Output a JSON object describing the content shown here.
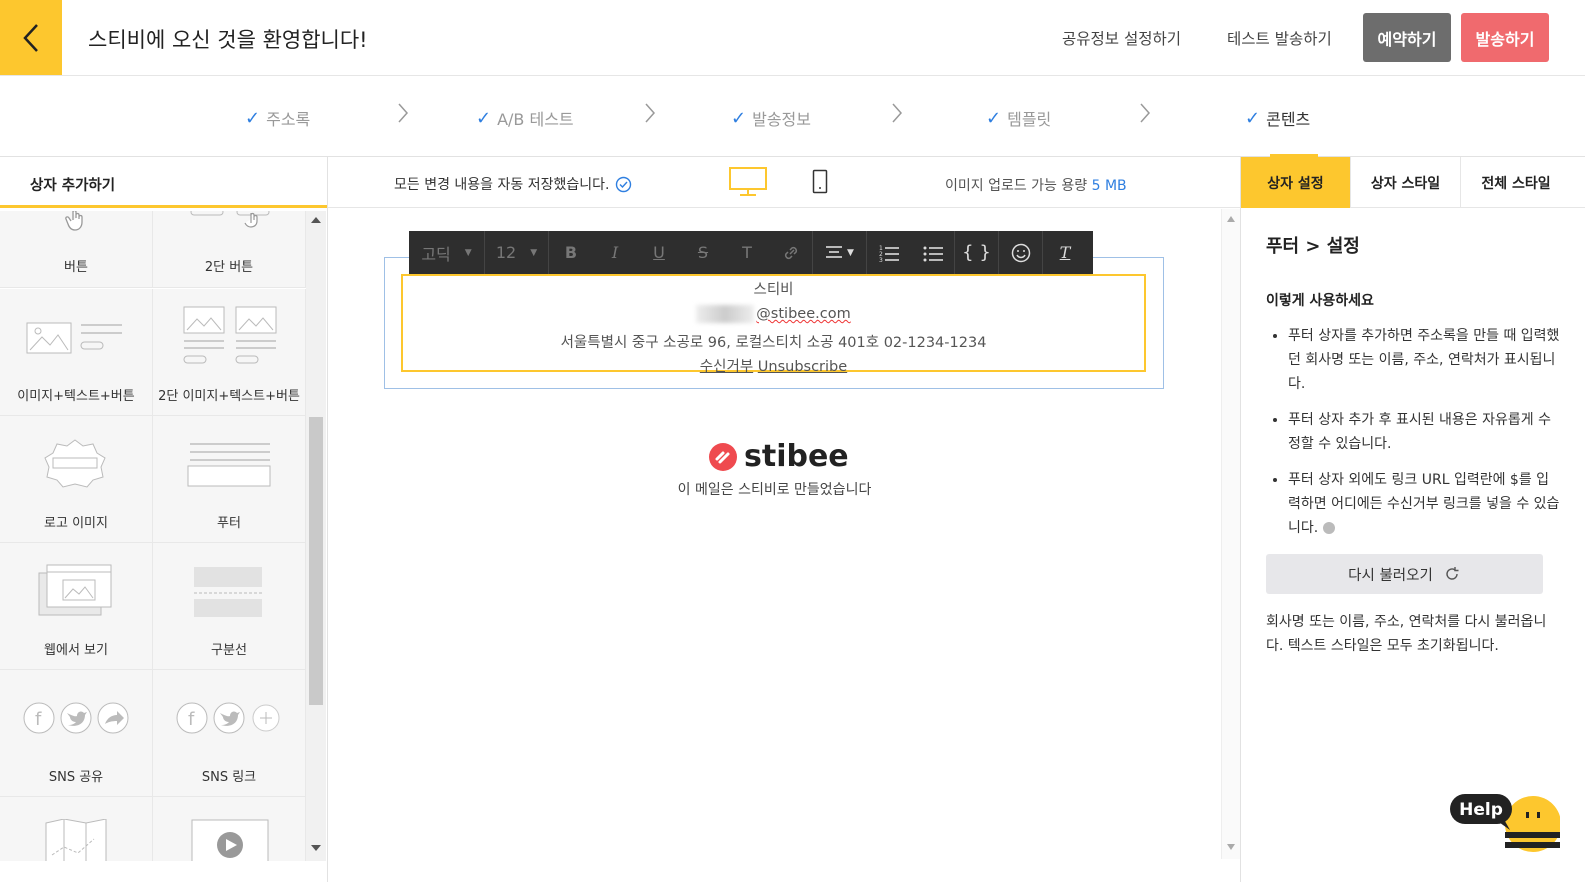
{
  "header": {
    "title": "스티비에 오신 것을 환영합니다!",
    "share_settings": "공유정보 설정하기",
    "test_send": "테스트 발송하기",
    "reserve": "예약하기",
    "send": "발송하기"
  },
  "steps": [
    {
      "label": "주소록"
    },
    {
      "label": "A/B 테스트"
    },
    {
      "label": "발송정보"
    },
    {
      "label": "템플릿"
    },
    {
      "label": "콘텐츠"
    }
  ],
  "left_panel": {
    "title": "상자 추가하기",
    "blocks": [
      {
        "label": "버튼"
      },
      {
        "label": "2단 버튼"
      },
      {
        "label": "이미지+텍스트+버튼"
      },
      {
        "label": "2단 이미지+텍스트+버튼"
      },
      {
        "label": "로고 이미지"
      },
      {
        "label": "푸터"
      },
      {
        "label": "웹에서 보기"
      },
      {
        "label": "구분선"
      },
      {
        "label": "SNS 공유"
      },
      {
        "label": "SNS 링크"
      }
    ]
  },
  "center": {
    "autosave": "모든 변경 내용을 자동 저장했습니다.",
    "upload_label": "이미지 업로드 가능 용량",
    "upload_size": "5 MB",
    "toolbar": {
      "font": "고딕",
      "size": "12",
      "bold": "B",
      "italic": "I",
      "underline": "U",
      "strike": "S",
      "textcolor": "T",
      "code": "{ }",
      "clear": "T"
    },
    "footer": {
      "name": "스티비",
      "email_domain": "@stibee.com",
      "address": "서울특별시 중구 소공로 96, 로컬스티치 소공 401호 02-1234-1234",
      "unsub_ko": "수신거부",
      "unsub_en": "Unsubscribe"
    },
    "brand": "stibee",
    "brand_caption": "이 메일은 스티비로 만들었습니다"
  },
  "right_panel": {
    "tabs": [
      "상자 설정",
      "상자 스타일",
      "전체 스타일"
    ],
    "title": "푸터 > 설정",
    "howto": "이렇게 사용하세요",
    "tips": [
      "푸터 상자를 추가하면 주소록을 만들 때 입력했던 회사명 또는 이름, 주소, 연락처가 표시됩니다.",
      "푸터 상자 추가 후 표시된 내용은 자유롭게 수정할 수 있습니다.",
      "푸터 상자 외에도 링크 URL 입력란에 $를 입력하면 어디에든 수신거부 링크를 넣을 수 있습니다."
    ],
    "reload": "다시 불러오기",
    "note": "회사명 또는 이름, 주소, 연락처를 다시 불러옵니다. 텍스트 스타일은 모두 초기화됩니다."
  },
  "help": "Help",
  "colors": {
    "accent": "#fdc72e",
    "send": "#f06a6e",
    "reserve": "#6d6d6d",
    "check": "#2f7fe0"
  }
}
